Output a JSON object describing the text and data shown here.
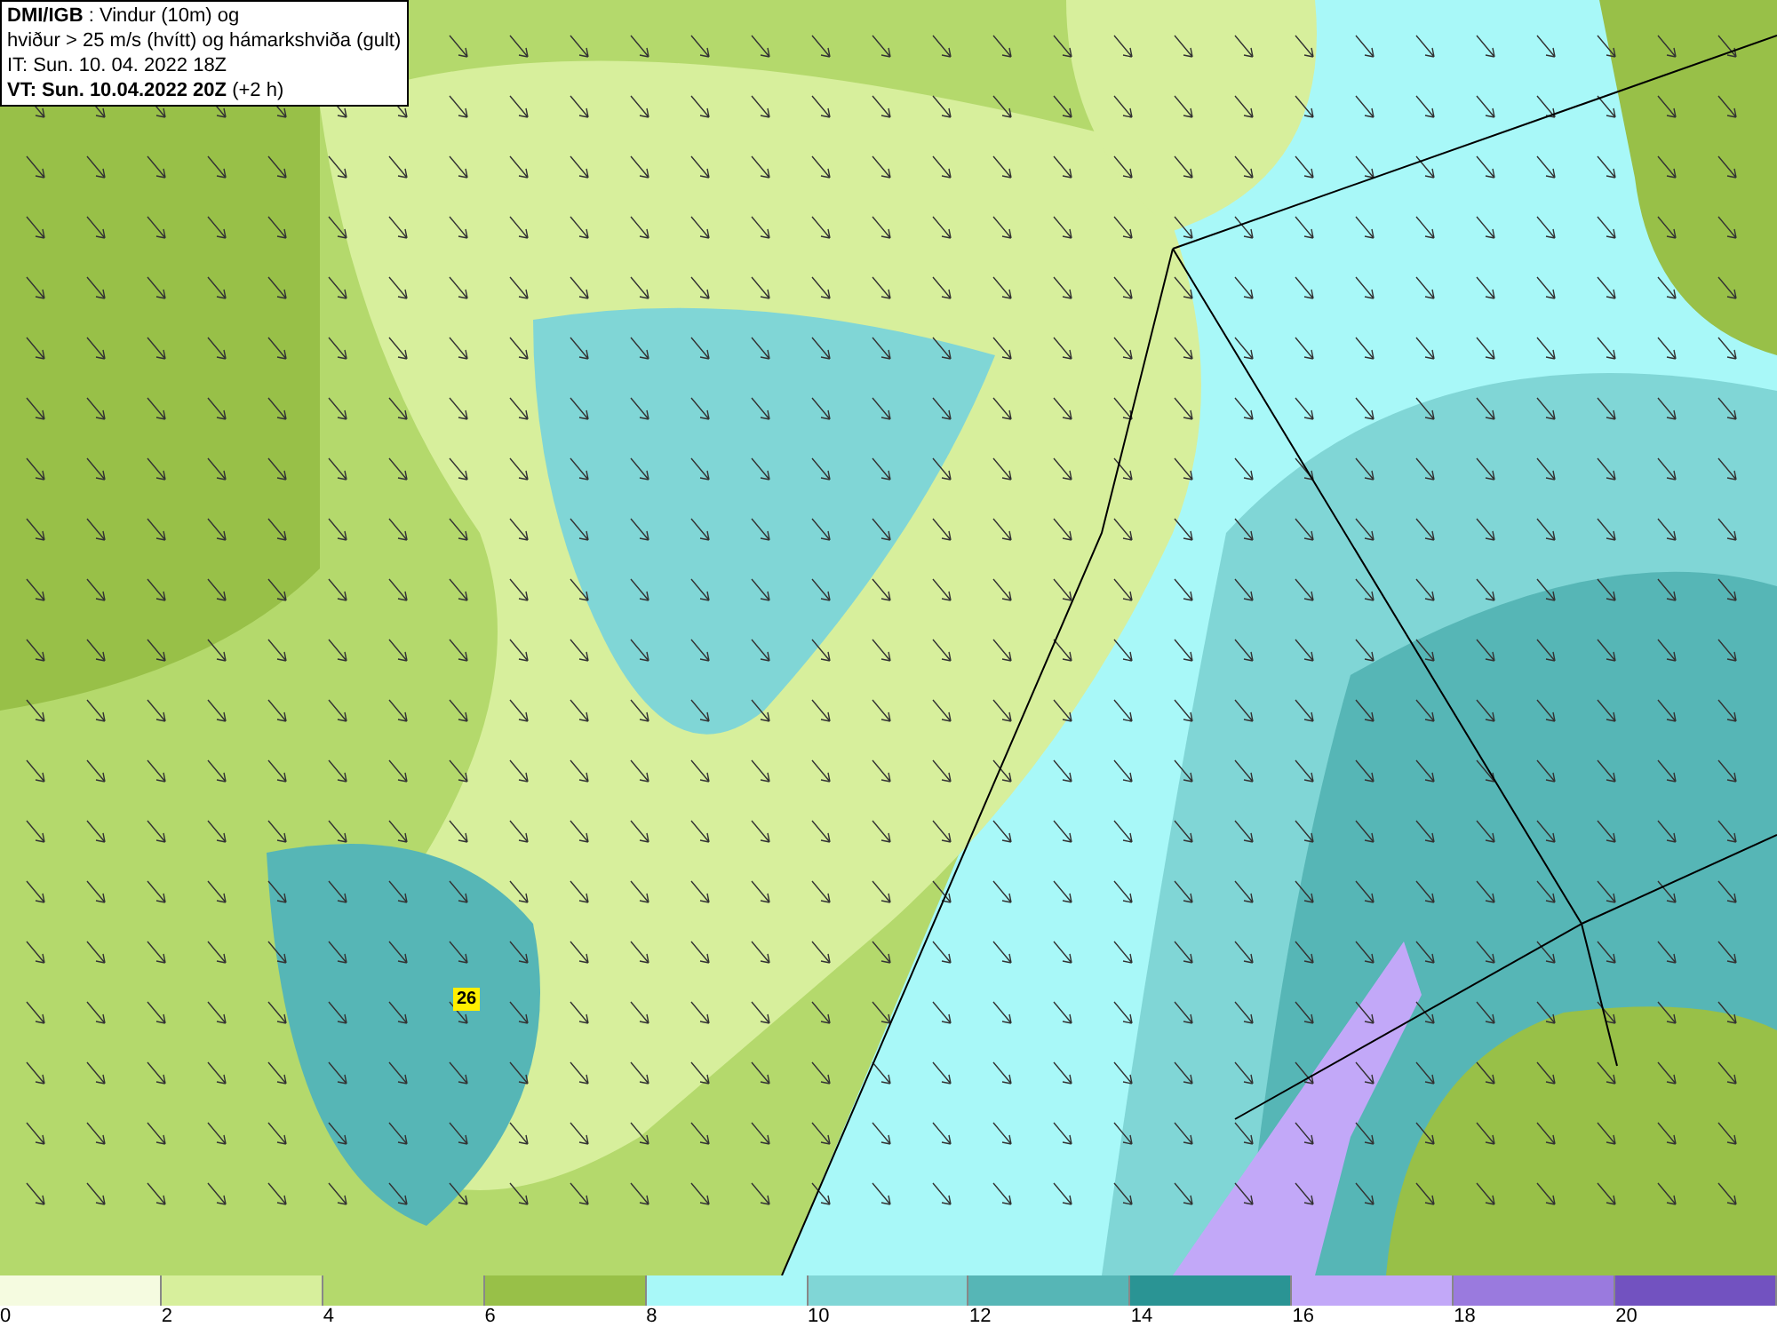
{
  "map": {
    "info_box": {
      "lines": [
        "**DMI/IGB** : Vindur (10m) og",
        "hviður > 25 m/s (hvítt) og hámarkshviða (gult)",
        "IT: Sun. 10. 04. 2022 18Z",
        "**VT: Sun. 10.04.2022 20Z** (+2 h)"
      ]
    },
    "max_gust": {
      "value": "26"
    }
  },
  "legend": {
    "bins": [
      {
        "label": "0",
        "color": "#f5fbe0"
      },
      {
        "label": "2",
        "color": "#d7ef9c"
      },
      {
        "label": "4",
        "color": "#b4d96c"
      },
      {
        "label": "6",
        "color": "#98c048"
      },
      {
        "label": "8",
        "color": "#a8f8f8"
      },
      {
        "label": "10",
        "color": "#80d6d6"
      },
      {
        "label": "12",
        "color": "#56b6b6"
      },
      {
        "label": "14",
        "color": "#2a9494"
      },
      {
        "label": "16",
        "color": "#c2a8f8"
      },
      {
        "label": "18",
        "color": "#9a7ade"
      },
      {
        "label": "20",
        "color": "#7252c0"
      }
    ]
  }
}
